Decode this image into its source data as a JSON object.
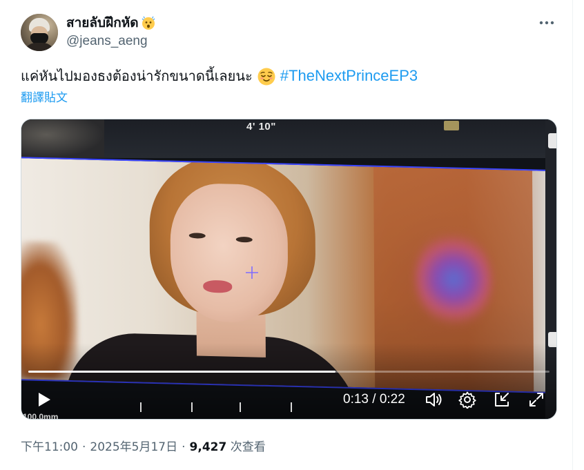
{
  "author": {
    "display_name": "สายลับฝึกหัด",
    "handle": "@jeans_aeng",
    "name_emoji": "astonished-face"
  },
  "tweet": {
    "text": "แค่หันไปมองธงต้องน่ารักขนาดนี้เลยนะ",
    "emoji": "relieved-face",
    "hashtag": "#TheNextPrinceEP3",
    "translate_label": "翻譯貼文"
  },
  "video": {
    "overlay_label": "4' 10\"",
    "bottom_overlay_text": "100.0mm",
    "current_time": "0:13",
    "separator": "/",
    "duration": "0:22",
    "progress_fraction": 0.59
  },
  "meta": {
    "time": "下午11:00",
    "date": "2025年5月17日",
    "views_count": "9,427",
    "views_label": "次查看"
  },
  "colors": {
    "accent": "#1d9bf0",
    "secondary_text": "#536471",
    "primary_text": "#0f1419"
  }
}
